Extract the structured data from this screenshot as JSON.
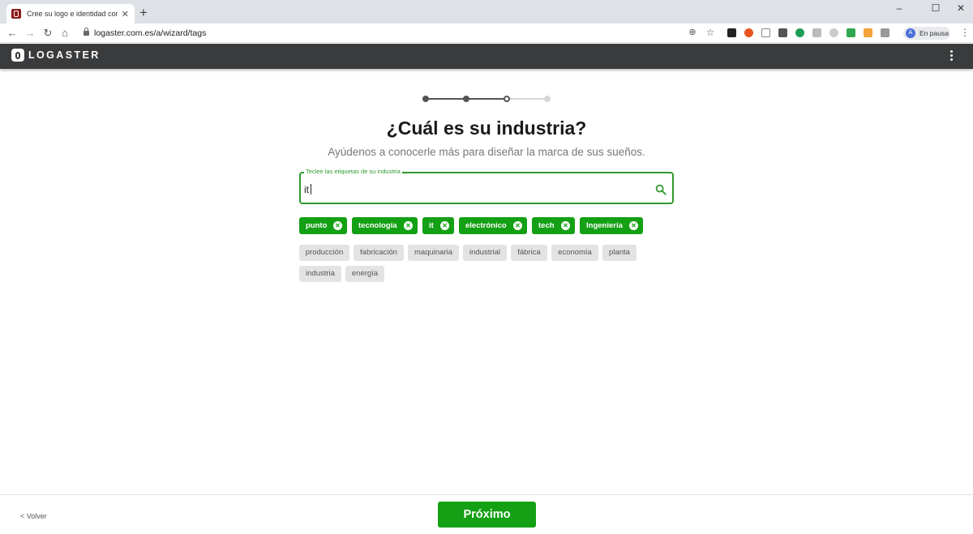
{
  "browser": {
    "tab_title": "Cree su logo e identidad corpora",
    "tab_close": "✕",
    "new_tab": "+",
    "url": "logaster.com.es/a/wizard/tags",
    "profile_initial": "A",
    "profile_label": "En pausa"
  },
  "app": {
    "logo_text": "LOGASTER"
  },
  "wizard": {
    "steps_total": 4,
    "current_step": 3,
    "colors": {
      "done": "#555555",
      "pending": "#d6d6d6",
      "accent": "#14a014"
    },
    "title": "¿Cuál es su industria?",
    "subtitle": "Ayúdenos a conocerle más para diseñar la marca de sus sueños.",
    "search": {
      "label": "Teclee las etiquetas de su industria",
      "value": "it"
    },
    "selected_tags": [
      "punto",
      "tecnología",
      "it",
      "electrónico",
      "tech",
      "Ingeniería"
    ],
    "suggested_tags": [
      "producción",
      "fabricación",
      "maquinaria",
      "industrial",
      "fábrica",
      "economía",
      "planta",
      "industria",
      "energía"
    ]
  },
  "footer": {
    "back_label": "< Volver",
    "next_label": "Próximo"
  }
}
